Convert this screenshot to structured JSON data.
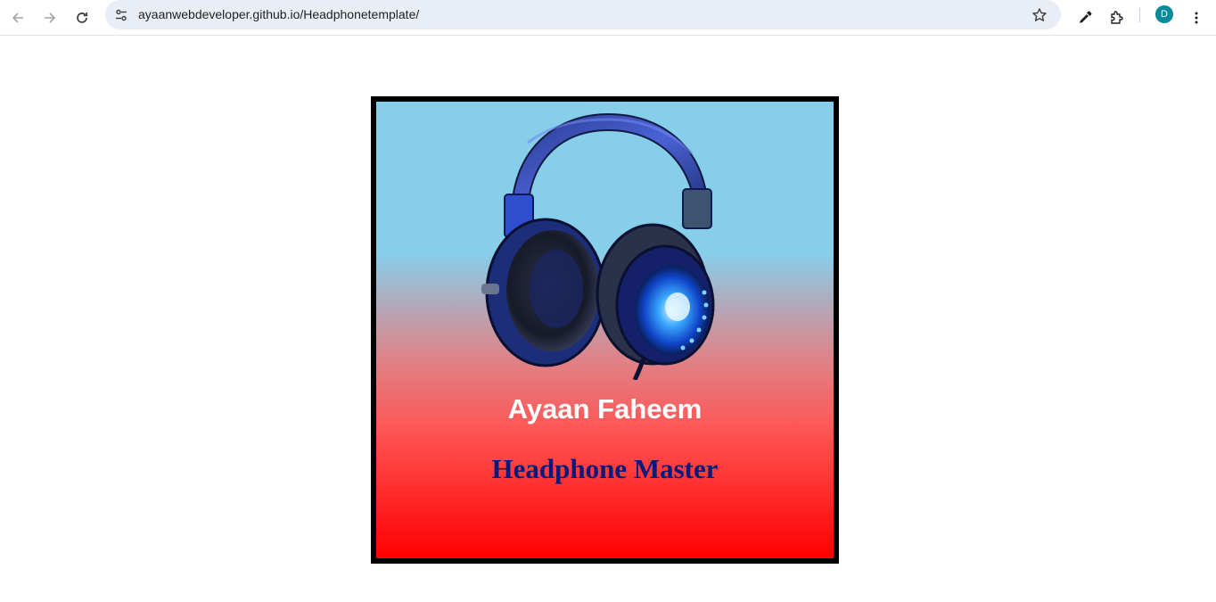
{
  "browser": {
    "url": "ayaanwebdeveloper.github.io/Headphonetemplate/",
    "profile_initial": "D",
    "icons": {
      "back": "arrow-left-icon",
      "forward": "arrow-right-icon",
      "reload": "reload-icon",
      "site_info": "tune-icon",
      "bookmark": "star-icon",
      "eyedropper": "eyedropper-icon",
      "extensions": "puzzle-icon",
      "menu": "kebab-menu-icon"
    }
  },
  "card": {
    "name": "Ayaan Faheem",
    "tagline": "Headphone Master",
    "image": "headphone-image",
    "colors": {
      "border": "#000000",
      "gradient_top": "#87ceeb",
      "gradient_bottom": "#ff0000",
      "name": "#ffffff",
      "tagline": "#0b1a7a"
    }
  }
}
